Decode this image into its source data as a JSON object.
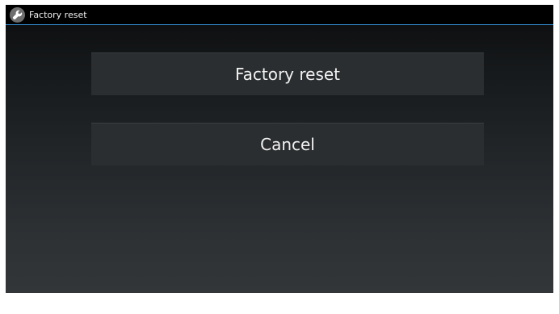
{
  "titlebar": {
    "icon": "wrench-icon",
    "title": "Factory reset"
  },
  "actions": {
    "factory_reset_label": "Factory reset",
    "cancel_label": "Cancel"
  },
  "colors": {
    "titlebar_background": "#000000",
    "titlebar_divider": "#2f86c6",
    "button_background": "#2b2e30",
    "text": "#f2f2f2"
  }
}
